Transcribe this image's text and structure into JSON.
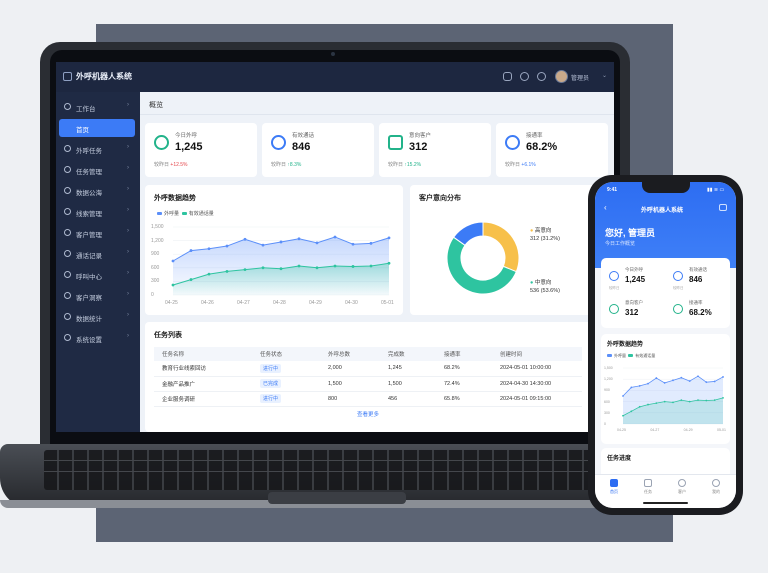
{
  "app": {
    "title": "外呼机器人系统",
    "username": "管理员"
  },
  "sidebar": {
    "items": [
      {
        "label": "工作台",
        "arrow": "›"
      },
      {
        "label": "首页"
      },
      {
        "label": "外呼任务",
        "arrow": "›"
      },
      {
        "label": "任务管理",
        "arrow": "›"
      },
      {
        "label": "数据公海",
        "arrow": "›"
      },
      {
        "label": "线索管理",
        "arrow": "›"
      },
      {
        "label": "客户管理",
        "arrow": "›"
      },
      {
        "label": "通话记录",
        "arrow": "›"
      },
      {
        "label": "呼叫中心",
        "arrow": "›"
      },
      {
        "label": "客户洞察",
        "arrow": "›"
      },
      {
        "label": "数据统计",
        "arrow": "›"
      },
      {
        "label": "系统设置",
        "arrow": "›"
      }
    ]
  },
  "breadcrumb": "概览",
  "stats": [
    {
      "label": "今日外呼",
      "value": "1,245",
      "compare": "较昨日",
      "delta": "+12.5%",
      "color": "#22b38a",
      "delta_color": "#e5484d"
    },
    {
      "label": "有效通话",
      "value": "846",
      "compare": "较昨日",
      "delta": "↑8.3%",
      "color": "#3c7bf6",
      "delta_color": "#22b38a"
    },
    {
      "label": "意向客户",
      "value": "312",
      "compare": "较昨日",
      "delta": "↑15.2%",
      "color": "#22b38a",
      "delta_color": "#22b38a"
    },
    {
      "label": "接通率",
      "value": "68.2%",
      "compare": "较昨日",
      "delta": "+6.1%",
      "color": "#3c7bf6",
      "delta_color": "#3c7bf6"
    }
  ],
  "trend": {
    "title": "外呼数据趋势",
    "legend": [
      "外呼量",
      "有效通话量"
    ]
  },
  "chart_data": {
    "type": "area",
    "categories": [
      "04-25",
      "04-26",
      "04-27",
      "04-28",
      "04-29",
      "04-30",
      "05-01"
    ],
    "x": [
      0,
      0.5,
      1,
      1.5,
      2,
      2.5,
      3,
      3.5,
      4,
      4.5,
      5,
      5.5,
      6
    ],
    "yticks": [
      0,
      300,
      600,
      900,
      1200,
      1500
    ],
    "ylim": [
      0,
      1500
    ],
    "series": [
      {
        "name": "外呼量",
        "color": "#5b8ff9",
        "values": [
          750,
          980,
          1020,
          1080,
          1230,
          1100,
          1170,
          1240,
          1150,
          1280,
          1120,
          1140,
          1260
        ]
      },
      {
        "name": "有效通话量",
        "color": "#2ec4a0",
        "values": [
          220,
          340,
          460,
          520,
          560,
          600,
          580,
          640,
          600,
          640,
          630,
          640,
          700
        ]
      }
    ]
  },
  "donut": {
    "title": "客户意向分布",
    "segments": [
      {
        "name": "高意向",
        "value": "312 (31.2%)",
        "pct": 31.2,
        "color": "#f7c04a"
      },
      {
        "name": "中意向",
        "value": "536 (53.6%)",
        "pct": 53.6,
        "color": "#2ec4a0"
      },
      {
        "name": "",
        "value": "",
        "pct": 15.2,
        "color": "#3c7bf6"
      }
    ]
  },
  "tasks": {
    "title": "任务列表",
    "headers": [
      "任务名称",
      "任务状态",
      "外呼总数",
      "完成数",
      "接通率",
      "创建时间"
    ],
    "rows": [
      [
        "教育行业线索回访",
        "进行中",
        "2,000",
        "1,245",
        "68.2%",
        "2024-05-01 10:00:00"
      ],
      [
        "金融产品推广",
        "已完成",
        "1,500",
        "1,500",
        "72.4%",
        "2024-04-30 14:30:00"
      ],
      [
        "企业服务调研",
        "进行中",
        "800",
        "456",
        "65.8%",
        "2024-05-01 09:15:00"
      ]
    ],
    "more": "查看更多"
  },
  "phone": {
    "time": "9:41",
    "status": "▮▮ ≋ ▭",
    "title": "外呼机器人系统",
    "greeting": "您好, 管理员",
    "subtitle": "今日工作概览",
    "stats": [
      {
        "label": "今日外呼",
        "value": "1,245",
        "compare": "较昨日",
        "color": "#3c7bf6"
      },
      {
        "label": "有效通话",
        "value": "846",
        "compare": "较昨日",
        "color": "#3c7bf6"
      },
      {
        "label": "意向客户",
        "value": "312",
        "compare": "较昨日",
        "color": "#22b38a"
      },
      {
        "label": "接通率",
        "value": "68.2%",
        "compare": "较昨日",
        "color": "#22b38a"
      }
    ],
    "trend_title": "外呼数据趋势",
    "legend": [
      "外呼量",
      "有效通话量"
    ],
    "yticks": [
      "1,500",
      "1,200",
      "900",
      "600",
      "300",
      "0"
    ],
    "xticks": [
      "04-25",
      "04-27",
      "04-29",
      "05-01"
    ],
    "progress_title": "任务进度",
    "tabs": [
      "首页",
      "任务",
      "客户",
      "我的"
    ]
  }
}
